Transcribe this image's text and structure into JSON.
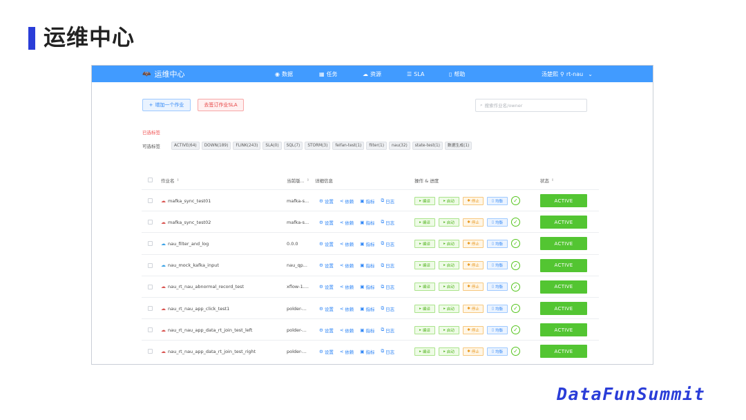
{
  "slide": {
    "title": "运维中心",
    "footer_logo": "DataFunSummit"
  },
  "nav": {
    "brand": "运维中心",
    "menu": [
      {
        "label": "数据",
        "icon": "eye-icon"
      },
      {
        "label": "任务",
        "icon": "grid-icon"
      },
      {
        "label": "资源",
        "icon": "cloud-icon"
      },
      {
        "label": "SLA",
        "icon": "list-icon"
      },
      {
        "label": "帮助",
        "icon": "phone-icon"
      }
    ],
    "user": "汤楚熙",
    "location": "rt-nau"
  },
  "toolbar": {
    "add_job": "增加一个作业",
    "subscribe_sla": "去签订作业SLA",
    "search_placeholder": "搜索作业名/owner"
  },
  "filters": {
    "selected_label": "已选标签",
    "optional_label": "可选标签",
    "tags": [
      "ACTIVE(64)",
      "DOWN(189)",
      "FLINK(243)",
      "SLA(0)",
      "SQL(7)",
      "STORM(3)",
      "feifan-test(1)",
      "filter(1)",
      "nau(32)",
      "state-test(1)",
      "数据生成(1)"
    ]
  },
  "table": {
    "headers": {
      "job_name": "作业名",
      "current_version": "当前版...",
      "details": "详细信息",
      "ops": "操作 & 进度",
      "status": "状态"
    },
    "info_actions": [
      "设置",
      "依赖",
      "指标",
      "日志"
    ],
    "op_labels": {
      "compile": "编译",
      "start": "启动",
      "stop": "停止",
      "balance": "均衡"
    },
    "rows": [
      {
        "name": "mafka_sync_test01",
        "version": "mafka-s...",
        "status": "ACTIVE",
        "icon": "red"
      },
      {
        "name": "mafka_sync_test02",
        "version": "mafka-s...",
        "status": "ACTIVE",
        "icon": "red"
      },
      {
        "name": "nau_filter_and_log",
        "version": "0.0.0",
        "status": "ACTIVE",
        "icon": "blue"
      },
      {
        "name": "nau_mock_kafka_input",
        "version": "nau_qp...",
        "status": "ACTIVE",
        "icon": "blue"
      },
      {
        "name": "nau_rt_nau_abnormal_record_test",
        "version": "xflow-1....",
        "status": "ACTIVE",
        "icon": "red"
      },
      {
        "name": "nau_rt_nau_app_click_test1",
        "version": "polder-...",
        "status": "ACTIVE",
        "icon": "red"
      },
      {
        "name": "nau_rt_nau_app_data_rt_join_test_left",
        "version": "polder-...",
        "status": "ACTIVE",
        "icon": "red"
      },
      {
        "name": "nau_rt_nau_app_data_rt_join_test_right",
        "version": "polder-...",
        "status": "ACTIVE",
        "icon": "red"
      }
    ]
  }
}
